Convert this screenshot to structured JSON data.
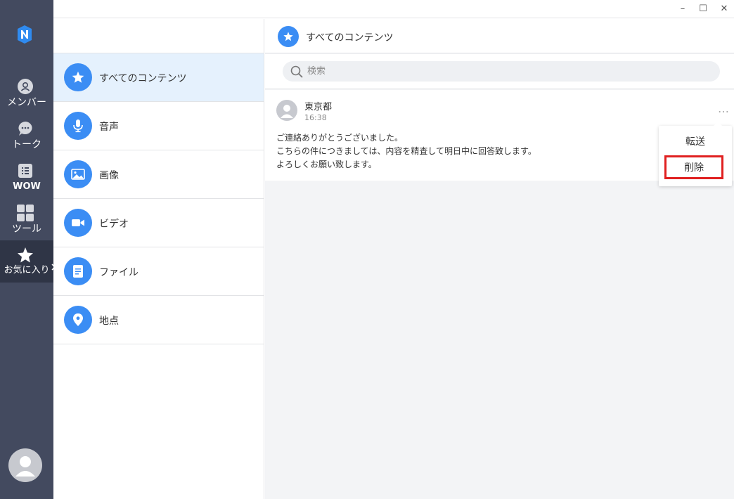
{
  "nav": {
    "items": [
      {
        "label": "メンバー",
        "icon": "member-icon"
      },
      {
        "label": "トーク",
        "icon": "talk-icon"
      },
      {
        "label": "WOW",
        "icon": "wow-icon"
      },
      {
        "label": "ツール",
        "icon": "tools-icon"
      },
      {
        "label": "お気に入り",
        "icon": "star-icon"
      }
    ],
    "active": "お気に入り"
  },
  "categories": [
    {
      "label": "すべてのコンテンツ",
      "icon": "star-icon"
    },
    {
      "label": "音声",
      "icon": "microphone-icon"
    },
    {
      "label": "画像",
      "icon": "image-icon"
    },
    {
      "label": "ビデオ",
      "icon": "video-icon"
    },
    {
      "label": "ファイル",
      "icon": "file-icon"
    },
    {
      "label": "地点",
      "icon": "location-pin-icon"
    }
  ],
  "content": {
    "title": "すべてのコンテンツ",
    "search_placeholder": "検索",
    "message": {
      "sender": "東京都",
      "time": "16:38",
      "lines": [
        "ご連絡ありがとうございました。",
        "こちらの件につきましては、内容を精査して明日中に回答致します。",
        "よろしくお願い致します。"
      ],
      "more": "…"
    }
  },
  "context_menu": {
    "forward": "転送",
    "delete": "削除"
  },
  "window": {
    "minimize": "–",
    "maximize": "☐",
    "close": "✕"
  },
  "colors": {
    "rail": "#434a5f",
    "accent": "#3b8df4",
    "selected_bg": "#e5f1fd",
    "highlight": "#e02020"
  }
}
